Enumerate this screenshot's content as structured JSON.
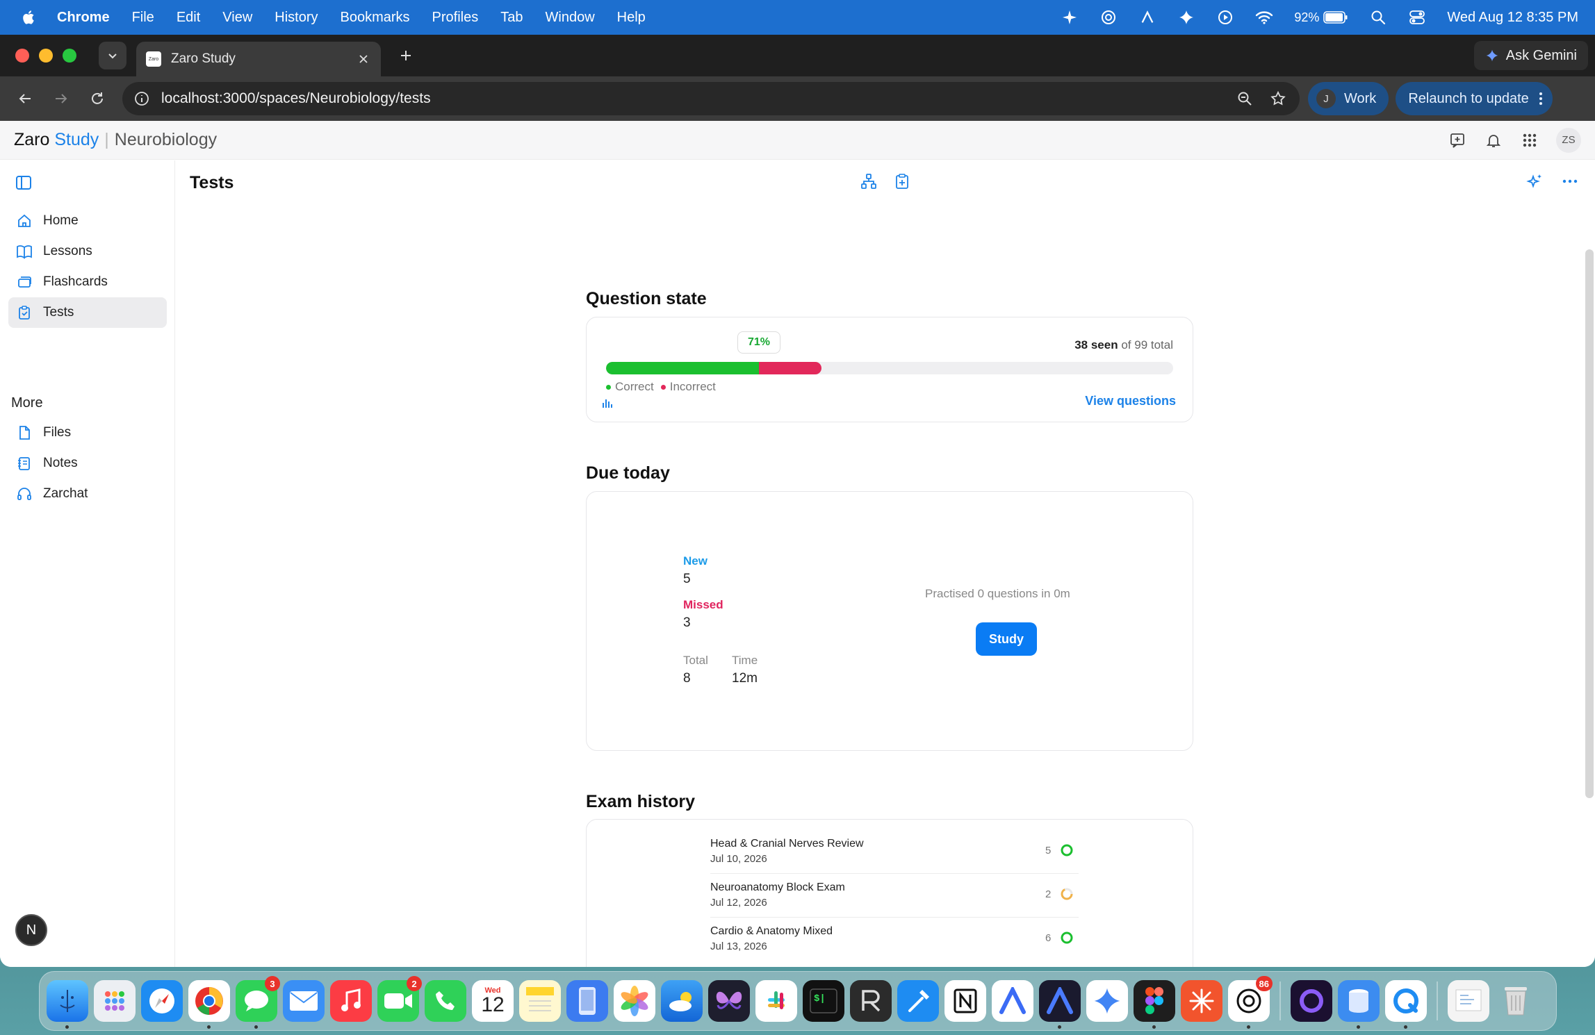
{
  "menubar": {
    "app_name": "Chrome",
    "menus": [
      "File",
      "Edit",
      "View",
      "History",
      "Bookmarks",
      "Profiles",
      "Tab",
      "Window",
      "Help"
    ],
    "battery": "92%",
    "clock": "Wed Aug 12  8:35 PM"
  },
  "browser": {
    "tab_title": "Zaro Study",
    "favicon_text": "Zaro",
    "url": "localhost:3000/spaces/Neurobiology/tests",
    "ask_gemini": "Ask Gemini",
    "profile_initial": "J",
    "profile_name": "Work",
    "relaunch": "Relaunch to update"
  },
  "app": {
    "brand_first": "Zaro",
    "brand_second": "Study",
    "space_name": "Neurobiology",
    "avatar_initials": "ZS",
    "accent_color": "#1c82e8"
  },
  "sidebar": {
    "items": [
      {
        "label": "Home",
        "icon": "home-icon"
      },
      {
        "label": "Lessons",
        "icon": "book-icon"
      },
      {
        "label": "Flashcards",
        "icon": "cards-icon"
      },
      {
        "label": "Tests",
        "icon": "clipboard-check-icon",
        "active": true
      }
    ],
    "more_label": "More",
    "more_items": [
      {
        "label": "Files",
        "icon": "file-icon"
      },
      {
        "label": "Notes",
        "icon": "notes-icon"
      },
      {
        "label": "Zarchat",
        "icon": "headset-icon"
      }
    ],
    "badge": "N"
  },
  "page": {
    "title": "Tests"
  },
  "question_state": {
    "title": "Question state",
    "percent_label": "71%",
    "seen": "38 seen",
    "of_total": " of 99 total",
    "correct_fraction": 0.27,
    "incorrect_fraction": 0.11,
    "correct_label": "Correct",
    "incorrect_label": "Incorrect",
    "view_link": "View questions",
    "colors": {
      "correct": "#1bbf2f",
      "incorrect": "#e2285a"
    }
  },
  "due_today": {
    "title": "Due today",
    "new_label": "New",
    "new_value": "5",
    "missed_label": "Missed",
    "missed_value": "3",
    "total_label": "Total",
    "total_value": "8",
    "time_label": "Time",
    "time_value": "12m",
    "practised": "Practised 0 questions in 0m",
    "study_button": "Study",
    "colors": {
      "new": "#1c9be8",
      "missed": "#e0245e"
    }
  },
  "exam_history": {
    "title": "Exam history",
    "rows": [
      {
        "name": "Head & Cranial Nerves Review",
        "date": "Jul 10, 2026",
        "count": "5",
        "status": "green"
      },
      {
        "name": "Neuroanatomy Block Exam",
        "date": "Jul 12, 2026",
        "count": "2",
        "status": "orange"
      },
      {
        "name": "Cardio & Anatomy Mixed",
        "date": "Jul 13, 2026",
        "count": "6",
        "status": "green"
      }
    ]
  },
  "dock": {
    "calendar_month": "Wed",
    "calendar_day": "12",
    "messages_badge": "3",
    "facetime_badge": "2",
    "chatgpt_badge": "86"
  }
}
